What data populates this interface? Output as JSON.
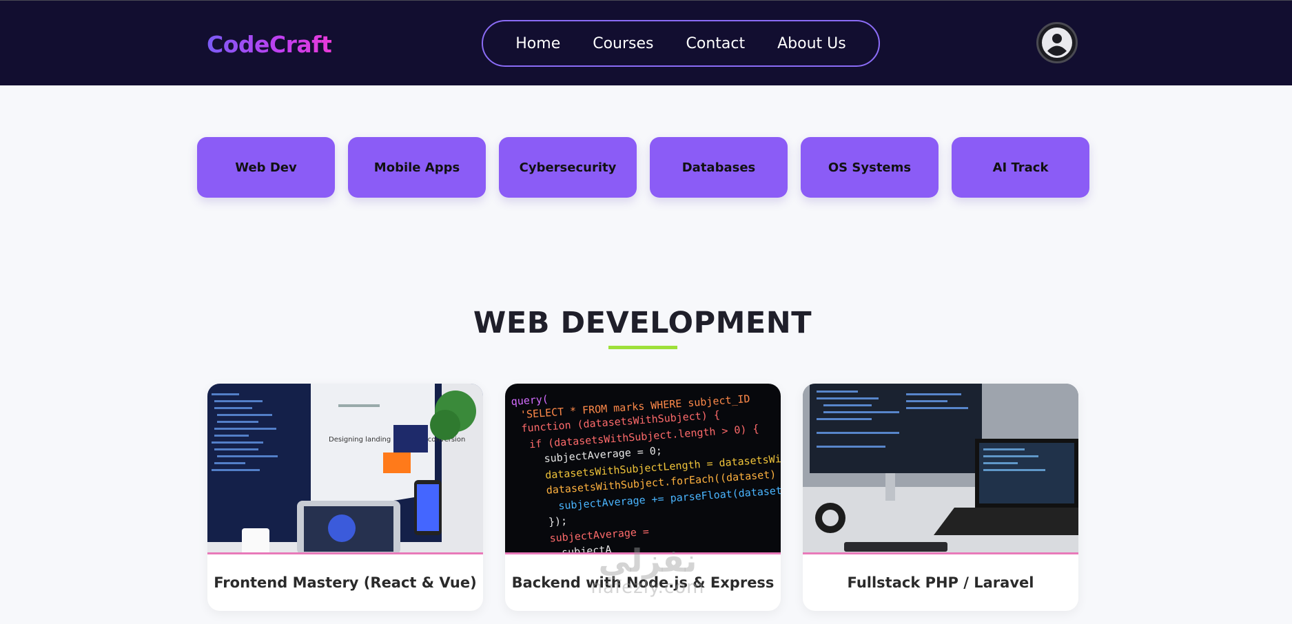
{
  "header": {
    "logo": "CodeCraft",
    "nav": [
      "Home",
      "Courses",
      "Contact",
      "About Us"
    ],
    "avatar_icon": "user-circle-icon"
  },
  "categories": [
    "Web Dev",
    "Mobile Apps",
    "Cybersecurity",
    "Databases",
    "OS Systems",
    "AI Track"
  ],
  "section": {
    "title": "WEB DEVELOPMENT"
  },
  "courses": [
    {
      "title": "Frontend Mastery (React & Vue)"
    },
    {
      "title": "Backend with Node.js & Express"
    },
    {
      "title": "Fullstack PHP / Laravel"
    }
  ],
  "code_snippet": [
    "query(",
    "'SELECT * FROM marks WHERE subject_ID",
    "function (datasetsWithSubject) {",
    "  if (datasetsWithSubject.length > 0) {",
    "    subjectAverage = 0;",
    "    datasetsWithSubjectLength = datasetsWithSu",
    "    datasetsWithSubject.forEach((dataset) => {",
    "      subjectAverage += parseFloat(dataset[",
    "    });",
    "    subjectAverage =",
    "    subjectA"
  ],
  "monitor_text": "Designing landing pages for conversion",
  "watermark": {
    "ar": "نفزلي",
    "en": "nafezly.com"
  },
  "colors": {
    "header_bg": "#120e30",
    "accent": "#8b5cf6",
    "underline": "#9ee03a",
    "card_border": "#e879b9"
  }
}
